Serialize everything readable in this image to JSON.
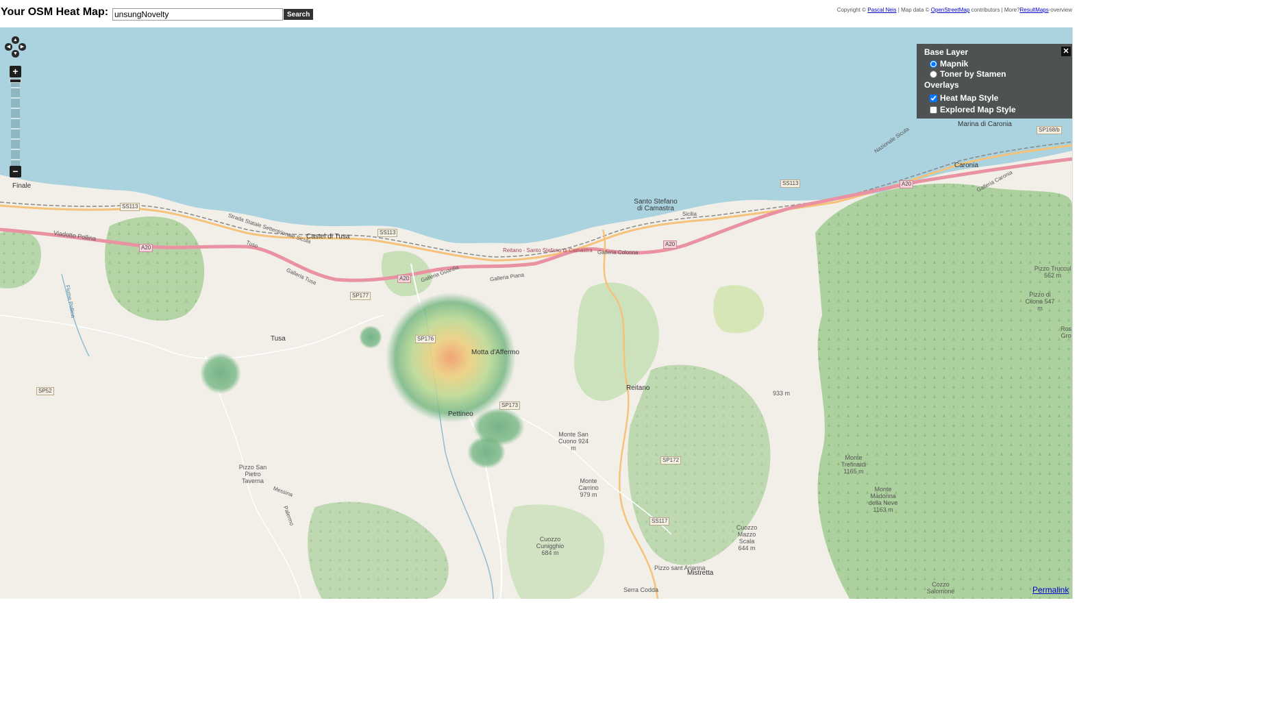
{
  "header": {
    "title": "Your OSM Heat Map:",
    "search_value": "unsungNovelty",
    "search_button": "Search"
  },
  "credits": {
    "prefix": "Copyright ©",
    "author_link": "Pascal Neis",
    "mid": "| Map data ©",
    "osm_link": "OpenStreetMap",
    "mid2": "contributors | More?",
    "more_link": "ResultMaps",
    "suffix": "-overview"
  },
  "map_controls": {
    "pan_up": "▲",
    "pan_down": "▼",
    "pan_left": "◀",
    "pan_right": "▶",
    "zoom_in": "+",
    "zoom_out": "−"
  },
  "layer_switcher": {
    "base_heading": "Base Layer",
    "base_layers": [
      {
        "label": "Mapnik",
        "selected": true
      },
      {
        "label": "Toner by Stamen",
        "selected": false
      }
    ],
    "overlays_heading": "Overlays",
    "overlays": [
      {
        "label": "Heat Map Style",
        "checked": true
      },
      {
        "label": "Explored Map Style",
        "checked": false
      }
    ],
    "close": "✕"
  },
  "permalink": "Permalink",
  "map_labels": {
    "places": [
      "Finale",
      "Castel di Tusa",
      "Tusa",
      "Motta d'Affermo",
      "Pettineo",
      "Santo Stefano di Camastra",
      "Reitano",
      "Caronia",
      "Marina di Caronia",
      "Mistretta",
      "Serra Codda",
      "Pizzo sant Arianna"
    ],
    "peaks": [
      "Pizzo San Pietro Taverna",
      "Monte San Cuono 924 m",
      "Monte Carrino 979 m",
      "Cuozzo Cunigghio 684 m",
      "Cuozzo Mazzo Scala 644 m",
      "Monte Trefinaidi 1165 m",
      "Monte Madonna della Neve 1163 m",
      "933 m",
      "Pizzo di Cilona 547 m",
      "Pizzo Truccul 562 m",
      "Cozzo Salomone",
      "Ros Gro"
    ],
    "roads": [
      "SS113",
      "SS113",
      "SS113",
      "A20",
      "A20",
      "A20",
      "A20",
      "SP177",
      "SP176",
      "SP173",
      "SP172",
      "SS117",
      "SP52",
      "SP168/b"
    ],
    "street_names": [
      "Viadotto Pollina",
      "Strada Statale Settentrionale Sicula",
      "Tuso",
      "Galleria Tusa",
      "Galleria Guardia",
      "Galleria Piana",
      "Reitano - Santo Stefano di Camastra",
      "Galleria Colonna",
      "Galleria Caronia",
      "Nazionale Sicula",
      "Sicilia",
      "Messina",
      "Palermo",
      "Fiume Pollina"
    ]
  }
}
